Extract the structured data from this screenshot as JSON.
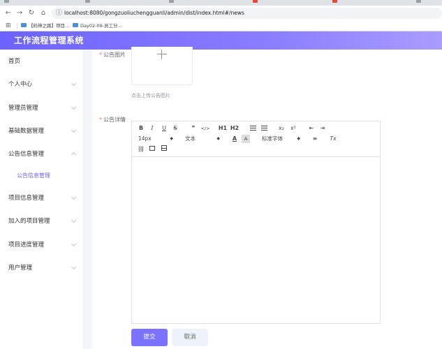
{
  "browser": {
    "url": "localhost:8080/gongzuoliuchengguanli/admin/dist/index.html#/news",
    "bookmarks": [
      "【码神之路】项目...",
      "Day02-09-员工分..."
    ]
  },
  "app": {
    "title": "工作流程管理系统"
  },
  "sidebar": {
    "items": [
      {
        "label": "首页"
      },
      {
        "label": "个人中心"
      },
      {
        "label": "管理员管理"
      },
      {
        "label": "基础数据管理"
      },
      {
        "label": "公告信息管理"
      },
      {
        "label": "公告信息管理"
      },
      {
        "label": "项目信息管理"
      },
      {
        "label": "加入的项目管理"
      },
      {
        "label": "项目进度管理"
      },
      {
        "label": "用户管理"
      }
    ]
  },
  "form": {
    "image_label": "公告图片",
    "upload_tip": "点击上传公告图片",
    "detail_label": "公告详情",
    "required_mark": "*",
    "submit_label": "提交",
    "cancel_label": "取消"
  },
  "editor": {
    "font_size": "14px",
    "header_select": "文本",
    "font_family": "标准字体",
    "buttons": {
      "bold": "B",
      "italic": "I",
      "underline": "U",
      "strike": "S",
      "quote": "❞",
      "code": "</>",
      "h1": "H1",
      "h2": "H2",
      "sub": "x₂",
      "sup": "x²",
      "clear": "Tx",
      "color": "A",
      "background": "A"
    }
  }
}
